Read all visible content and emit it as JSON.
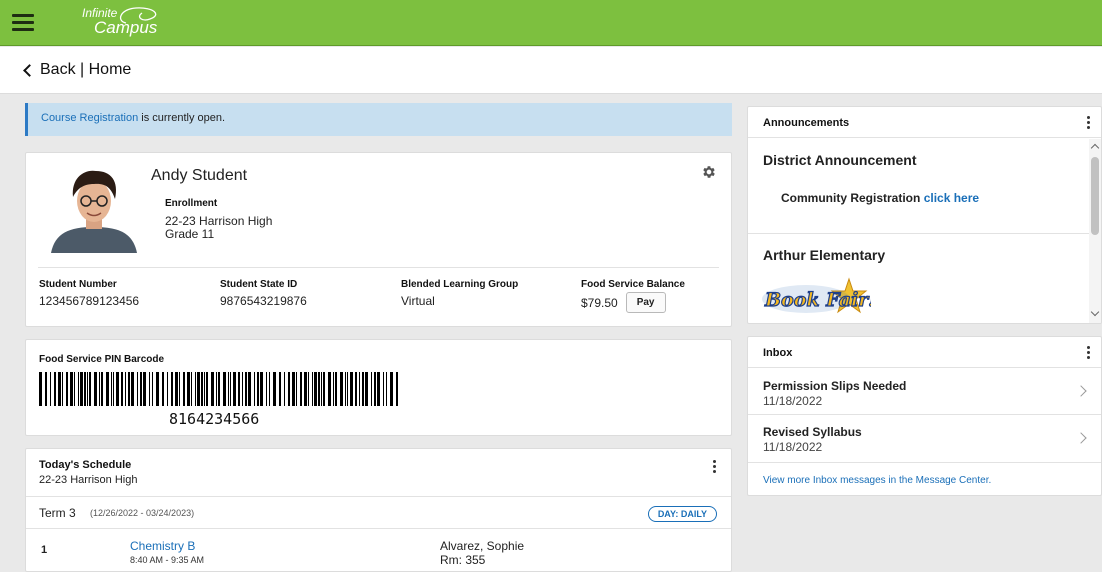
{
  "app": {
    "logo_line1": "Infinite",
    "logo_line2": "Campus"
  },
  "nav": {
    "back_label": "Back | Home"
  },
  "banner": {
    "link_text": "Course Registration",
    "text": " is currently open."
  },
  "student": {
    "name": "Andy Student",
    "enrollment_label": "Enrollment",
    "school": "22-23 Harrison High",
    "grade": "Grade 11",
    "fields": [
      {
        "label": "Student Number",
        "value": "123456789123456"
      },
      {
        "label": "Student State ID",
        "value": "9876543219876"
      },
      {
        "label": "Blended Learning Group",
        "value": "Virtual"
      },
      {
        "label": "Food Service Balance",
        "value": "$79.50"
      }
    ],
    "pay_label": "Pay"
  },
  "barcode": {
    "title": "Food Service PIN Barcode",
    "number": "8164234566"
  },
  "schedule": {
    "title": "Today's Schedule",
    "school": "22-23 Harrison High",
    "term": "Term 3",
    "term_dates": "(12/26/2022 - 03/24/2023)",
    "day_badge": "DAY: DAILY",
    "periods": [
      {
        "period": "1",
        "course": "Chemistry B",
        "time": "8:40 AM - 9:35 AM",
        "teacher": "Alvarez, Sophie",
        "room": "Rm: 355"
      }
    ]
  },
  "announcements": {
    "title": "Announcements",
    "items": [
      {
        "heading": "District Announcement",
        "body": "Community Registration ",
        "link": "click here"
      },
      {
        "heading": "Arthur Elementary",
        "image_text": "Book Fair!"
      }
    ]
  },
  "inbox": {
    "title": "Inbox",
    "messages": [
      {
        "subject": "Permission Slips Needed",
        "date": "11/18/2022"
      },
      {
        "subject": "Revised Syllabus",
        "date": "11/18/2022"
      }
    ],
    "footer_link": "View more Inbox messages in the Message Center."
  },
  "colors": {
    "header_green": "#7dc03f",
    "link_blue": "#1a6fb8",
    "banner_blue": "#c7dff0"
  }
}
